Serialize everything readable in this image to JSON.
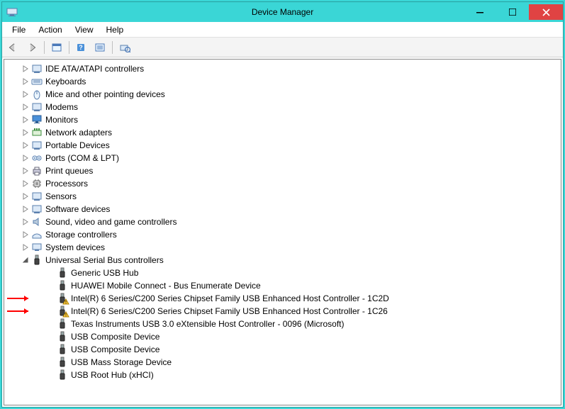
{
  "titlebar": {
    "title": "Device Manager"
  },
  "menubar": {
    "items": [
      "File",
      "Action",
      "View",
      "Help"
    ]
  },
  "toolbar": {
    "buttons": [
      "back",
      "forward",
      "show-hidden",
      "help",
      "properties",
      "scan-hardware"
    ]
  },
  "tree": {
    "categories": [
      {
        "label": "IDE ATA/ATAPI controllers",
        "expanded": false,
        "icon": "ide"
      },
      {
        "label": "Keyboards",
        "expanded": false,
        "icon": "keyboard"
      },
      {
        "label": "Mice and other pointing devices",
        "expanded": false,
        "icon": "mouse"
      },
      {
        "label": "Modems",
        "expanded": false,
        "icon": "modem"
      },
      {
        "label": "Monitors",
        "expanded": false,
        "icon": "monitor"
      },
      {
        "label": "Network adapters",
        "expanded": false,
        "icon": "network"
      },
      {
        "label": "Portable Devices",
        "expanded": false,
        "icon": "portable"
      },
      {
        "label": "Ports (COM & LPT)",
        "expanded": false,
        "icon": "ports"
      },
      {
        "label": "Print queues",
        "expanded": false,
        "icon": "printer"
      },
      {
        "label": "Processors",
        "expanded": false,
        "icon": "cpu"
      },
      {
        "label": "Sensors",
        "expanded": false,
        "icon": "sensor"
      },
      {
        "label": "Software devices",
        "expanded": false,
        "icon": "software"
      },
      {
        "label": "Sound, video and game controllers",
        "expanded": false,
        "icon": "sound"
      },
      {
        "label": "Storage controllers",
        "expanded": false,
        "icon": "storage"
      },
      {
        "label": "System devices",
        "expanded": false,
        "icon": "system"
      },
      {
        "label": "Universal Serial Bus controllers",
        "expanded": true,
        "icon": "usb",
        "children": [
          {
            "label": "Generic USB Hub",
            "icon": "usb",
            "warning": false
          },
          {
            "label": "HUAWEI Mobile Connect - Bus Enumerate Device",
            "icon": "usb",
            "warning": false
          },
          {
            "label": "Intel(R) 6 Series/C200 Series Chipset Family USB Enhanced Host Controller - 1C2D",
            "icon": "usb",
            "warning": true,
            "annotated": true
          },
          {
            "label": "Intel(R) 6 Series/C200 Series Chipset Family USB Enhanced Host Controller - 1C26",
            "icon": "usb",
            "warning": true,
            "annotated": true
          },
          {
            "label": "Texas Instruments USB 3.0 eXtensible Host Controller - 0096 (Microsoft)",
            "icon": "usb",
            "warning": false
          },
          {
            "label": "USB Composite Device",
            "icon": "usb",
            "warning": false
          },
          {
            "label": "USB Composite Device",
            "icon": "usb",
            "warning": false
          },
          {
            "label": "USB Mass Storage Device",
            "icon": "usb",
            "warning": false
          },
          {
            "label": "USB Root Hub (xHCI)",
            "icon": "usb",
            "warning": false
          }
        ]
      }
    ]
  }
}
